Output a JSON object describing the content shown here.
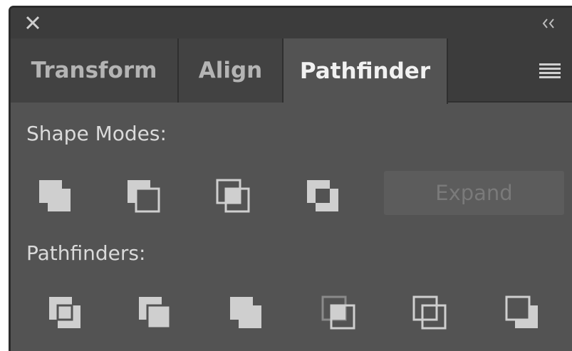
{
  "panel": {
    "tabs": [
      {
        "label": "Transform",
        "active": false
      },
      {
        "label": "Align",
        "active": false
      },
      {
        "label": "Pathfinder",
        "active": true
      }
    ],
    "shape_modes_label": "Shape Modes:",
    "pathfinders_label": "Pathfinders:",
    "expand_label": "Expand",
    "expand_enabled": false,
    "shape_mode_buttons": [
      "unite-icon",
      "minus-front-icon",
      "intersect-icon",
      "exclude-icon"
    ],
    "pathfinder_buttons": [
      "divide-icon",
      "trim-icon",
      "merge-icon",
      "crop-icon",
      "outline-icon",
      "minus-back-icon"
    ]
  },
  "colors": {
    "panel_bg": "#535353",
    "tab_bg": "#3c3c3c",
    "icon_fill": "#cfcfcf",
    "text": "#dadada"
  }
}
